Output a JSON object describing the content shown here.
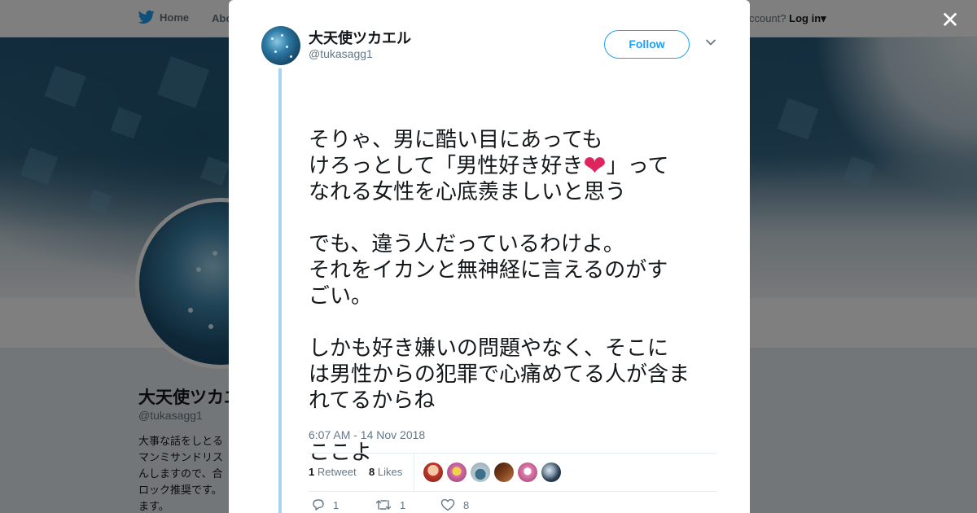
{
  "background_page": {
    "nav": {
      "home_label": "Home",
      "about_label": "Abo",
      "account_text": "ccount?",
      "login_label": "Log in"
    },
    "profile": {
      "name": "大天使ツカエル",
      "handle": "@tukasagg1",
      "bio_lines": [
        "大事な話をしとる",
        "マンミサンドリス",
        "んしますので、合",
        "ロック推奨です。",
        "ます。"
      ]
    }
  },
  "modal": {
    "author": {
      "name": "大天使ツカエル",
      "handle": "@tukasagg1"
    },
    "follow_label": "Follow",
    "tweet": {
      "p1_a": "そりゃ、男に酷い目にあっても",
      "p1_b": "けろっとして「男性好き好き",
      "p1_c": "」って",
      "p1_d": "なれる女性を心底羨ましいと思う",
      "p2": "でも、違う人だっているわけよ。\nそれをイカンと無神経に言えるのがす\nごい。",
      "p3": "しかも好き嫌いの問題やなく、そこに\nは男性からの犯罪で心痛めてる人が含ま\nれてるからね",
      "p4": "ここよ",
      "heart_emoji": "❤"
    },
    "timestamp": "6:07 AM - 14 Nov 2018",
    "stats": {
      "retweet_count": "1",
      "retweet_label": "Retweet",
      "likes_count": "8",
      "likes_label": "Likes"
    },
    "likers": [
      {
        "color": "#c0392b",
        "icon": "avatar-face-red"
      },
      {
        "color": "#d66fa8",
        "icon": "avatar-pink-yellow"
      },
      {
        "color": "#8fa9b5",
        "icon": "avatar-grey-figure"
      },
      {
        "color": "#7b3f1d",
        "icon": "avatar-brown-feather"
      },
      {
        "color": "#e17fb0",
        "icon": "avatar-pink-face"
      },
      {
        "color": "#2b3d52",
        "icon": "avatar-dark-figure"
      }
    ],
    "actions": {
      "reply_count": "1",
      "retweet_count": "1",
      "like_count": "8"
    }
  },
  "colors": {
    "accent": "#1da1f2",
    "thread_line": "#a6d4f2",
    "heart": "#e0245e"
  }
}
